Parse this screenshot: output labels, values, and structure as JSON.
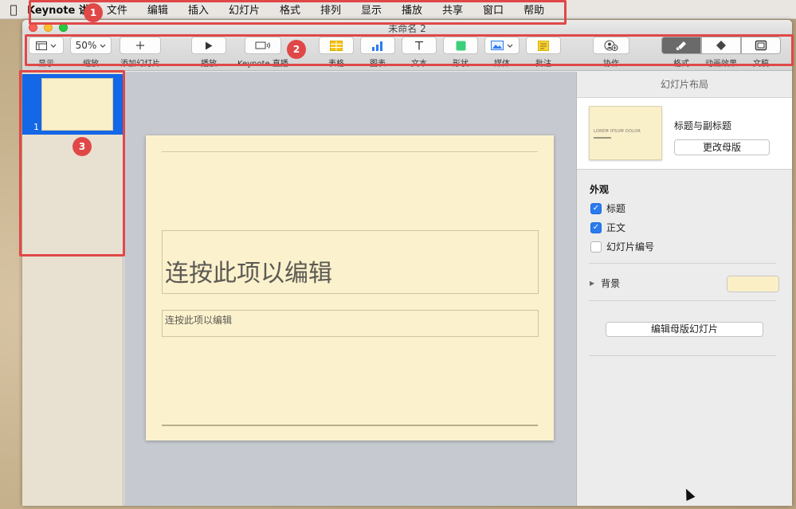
{
  "menubar": {
    "apple_icon": "apple-icon",
    "app_name": "Keynote",
    "app_suffix": "讲",
    "items": [
      "文件",
      "编辑",
      "插入",
      "幻灯片",
      "格式",
      "排列",
      "显示",
      "播放",
      "共享",
      "窗口",
      "帮助"
    ]
  },
  "window": {
    "title": "未命名 2"
  },
  "toolbar": {
    "view_label": "显示",
    "zoom_value": "50%",
    "zoom_label": "缩放",
    "add_slide_label": "添加幻灯片",
    "play_label": "播放",
    "keynote_live_label": "Keynote 直播",
    "table_label": "表格",
    "chart_label": "图表",
    "text_label": "文本",
    "shape_label": "形状",
    "media_label": "媒体",
    "comment_label": "批注",
    "collaborate_label": "协作",
    "format_label": "格式",
    "animate_label": "动画效果",
    "document_label": "文稿"
  },
  "navigator": {
    "slide_number": "1"
  },
  "slide": {
    "title_placeholder": "连按此项以编辑",
    "body_placeholder": "连按此项以编辑"
  },
  "inspector": {
    "header": "幻灯片布局",
    "layout_thumb_text": "LOREM IPSUM DOLOR",
    "layout_name": "标题与副标题",
    "change_master_label": "更改母版",
    "appearance_label": "外观",
    "checkboxes": [
      {
        "label": "标题",
        "checked": true
      },
      {
        "label": "正文",
        "checked": true
      },
      {
        "label": "幻灯片编号",
        "checked": false
      }
    ],
    "background_label": "背景",
    "background_color": "#fbefc6",
    "edit_master_label": "编辑母版幻灯片"
  },
  "annotations": {
    "badge1": "1",
    "badge2": "2",
    "badge3": "3",
    "color": "#e04848"
  }
}
